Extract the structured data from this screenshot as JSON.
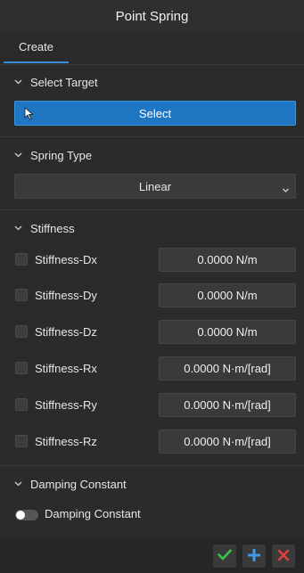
{
  "window": {
    "title": "Point Spring"
  },
  "tabs": [
    {
      "label": "Create"
    }
  ],
  "select_target": {
    "header": "Select Target",
    "button_label": "Select"
  },
  "spring_type": {
    "header": "Spring Type",
    "selected": "Linear"
  },
  "stiffness": {
    "header": "Stiffness",
    "rows": [
      {
        "label": "Stiffness-Dx",
        "value": "0.0000 N/m"
      },
      {
        "label": "Stiffness-Dy",
        "value": "0.0000 N/m"
      },
      {
        "label": "Stiffness-Dz",
        "value": "0.0000 N/m"
      },
      {
        "label": "Stiffness-Rx",
        "value": "0.0000 N·m/[rad]"
      },
      {
        "label": "Stiffness-Ry",
        "value": "0.0000 N·m/[rad]"
      },
      {
        "label": "Stiffness-Rz",
        "value": "0.0000 N·m/[rad]"
      }
    ]
  },
  "damping": {
    "header": "Damping Constant",
    "toggle_label": "Damping Constant",
    "enabled": false
  },
  "colors": {
    "accent": "#1f77c4",
    "ok": "#3cc24a",
    "add": "#3b9be8",
    "cancel": "#e0403a"
  }
}
